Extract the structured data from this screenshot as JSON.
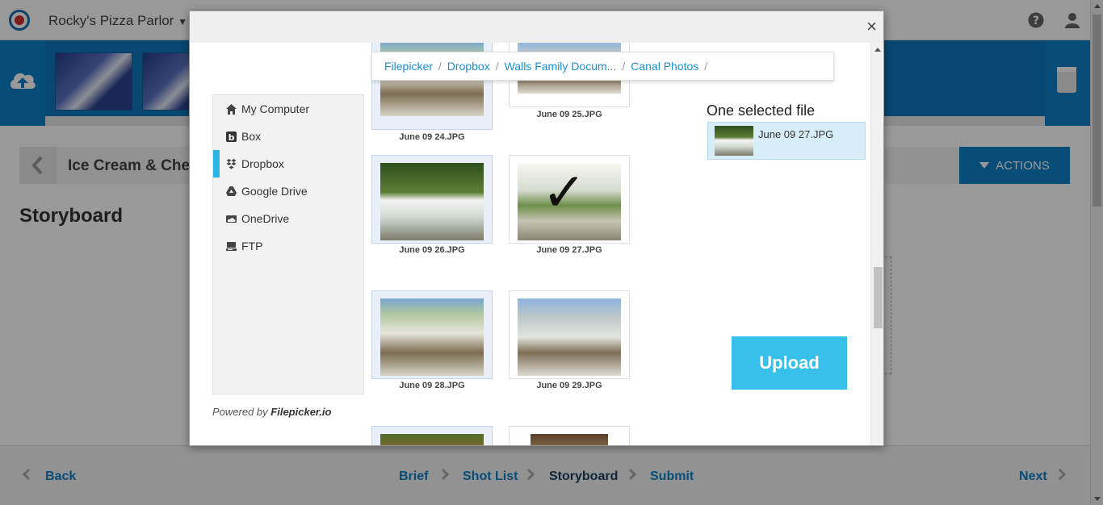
{
  "app": {
    "brand": "Rocky's Pizza Parlor"
  },
  "project": {
    "title": "Ice Cream & Che",
    "actions_label": "ACTIONS"
  },
  "page": {
    "heading": "Storyboard"
  },
  "bottom_nav": {
    "back": "Back",
    "next": "Next",
    "steps": [
      "Brief",
      "Shot List",
      "Storyboard",
      "Submit"
    ],
    "current": "Storyboard"
  },
  "modal": {
    "breadcrumb": [
      "Filepicker",
      "Dropbox",
      "Walls Family Docum...",
      "Canal Photos"
    ],
    "sources": [
      {
        "label": "My Computer",
        "icon": "home-icon"
      },
      {
        "label": "Box",
        "icon": "box-icon"
      },
      {
        "label": "Dropbox",
        "icon": "dropbox-icon",
        "active": true
      },
      {
        "label": "Google Drive",
        "icon": "google-drive-icon"
      },
      {
        "label": "OneDrive",
        "icon": "onedrive-icon"
      },
      {
        "label": "FTP",
        "icon": "ftp-icon"
      }
    ],
    "powered_prefix": "Powered by",
    "powered_brand": "Filepicker.io",
    "files": [
      "June 09 24.JPG",
      "June 09 25.JPG",
      "June 09 26.JPG",
      "June 09 27.JPG",
      "June 09 28.JPG",
      "June 09 29.JPG"
    ],
    "selected_title": "One selected file",
    "selected_file": "June 09 27.JPG",
    "upload_label": "Upload",
    "close_glyph": "×",
    "check_glyph": "✓"
  },
  "colors": {
    "brand_blue": "#0e7fc8",
    "upload": "#37c0ea",
    "active_source": "#2cb4e3"
  }
}
